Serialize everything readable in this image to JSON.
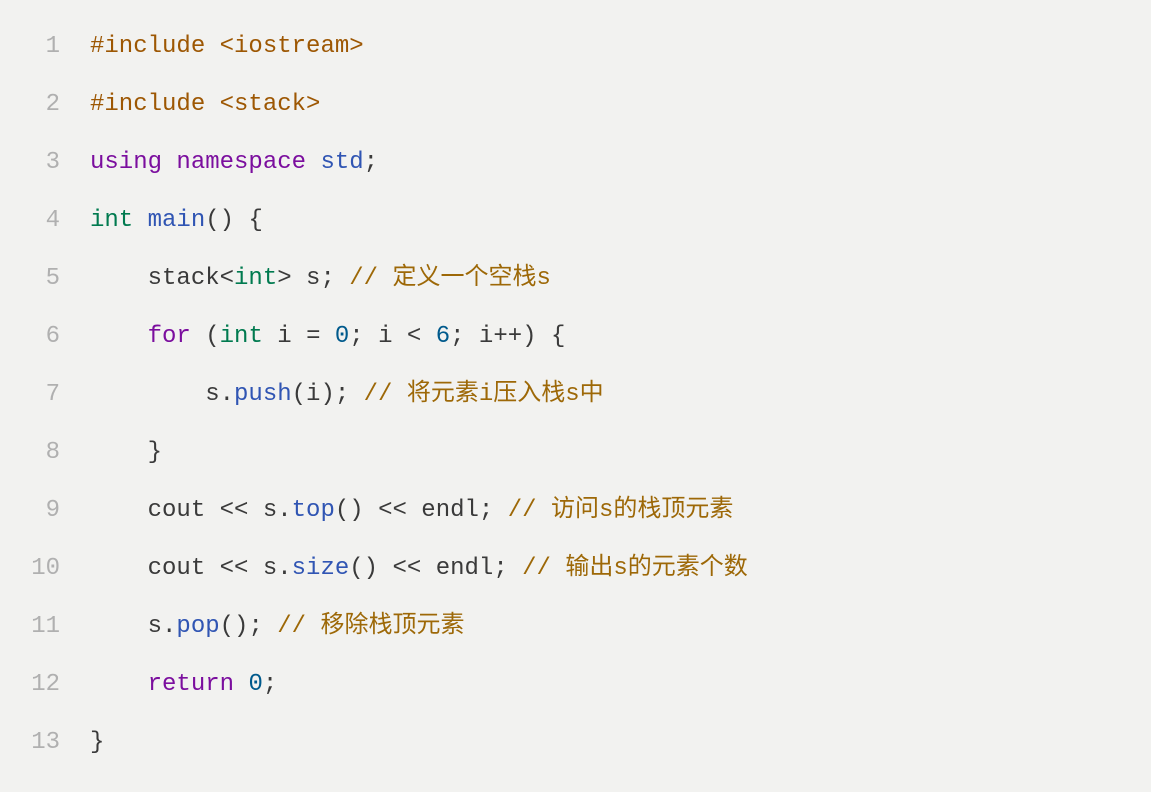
{
  "code": {
    "lines": [
      {
        "num": "1",
        "indent": "",
        "tokens": [
          {
            "cls": "tok-preproc",
            "text": "#include <iostream>"
          }
        ]
      },
      {
        "num": "2",
        "indent": "",
        "tokens": [
          {
            "cls": "tok-preproc",
            "text": "#include <stack>"
          }
        ]
      },
      {
        "num": "3",
        "indent": "",
        "tokens": [
          {
            "cls": "tok-keyword",
            "text": "using"
          },
          {
            "cls": "tok-plain",
            "text": " "
          },
          {
            "cls": "tok-keyword",
            "text": "namespace"
          },
          {
            "cls": "tok-plain",
            "text": " "
          },
          {
            "cls": "tok-func",
            "text": "std"
          },
          {
            "cls": "tok-punct",
            "text": ";"
          }
        ]
      },
      {
        "num": "4",
        "indent": "",
        "tokens": [
          {
            "cls": "tok-type",
            "text": "int"
          },
          {
            "cls": "tok-plain",
            "text": " "
          },
          {
            "cls": "tok-func",
            "text": "main"
          },
          {
            "cls": "tok-punct",
            "text": "() {"
          }
        ]
      },
      {
        "num": "5",
        "indent": "    ",
        "tokens": [
          {
            "cls": "tok-ident",
            "text": "stack"
          },
          {
            "cls": "tok-punct",
            "text": "<"
          },
          {
            "cls": "tok-type",
            "text": "int"
          },
          {
            "cls": "tok-punct",
            "text": "> s; "
          },
          {
            "cls": "tok-comment",
            "text": "// 定义一个空栈s"
          }
        ]
      },
      {
        "num": "6",
        "indent": "    ",
        "tokens": [
          {
            "cls": "tok-keyword",
            "text": "for"
          },
          {
            "cls": "tok-punct",
            "text": " ("
          },
          {
            "cls": "tok-type",
            "text": "int"
          },
          {
            "cls": "tok-plain",
            "text": " i "
          },
          {
            "cls": "tok-op",
            "text": "="
          },
          {
            "cls": "tok-plain",
            "text": " "
          },
          {
            "cls": "tok-number",
            "text": "0"
          },
          {
            "cls": "tok-punct",
            "text": "; i "
          },
          {
            "cls": "tok-op",
            "text": "<"
          },
          {
            "cls": "tok-plain",
            "text": " "
          },
          {
            "cls": "tok-number",
            "text": "6"
          },
          {
            "cls": "tok-punct",
            "text": "; i"
          },
          {
            "cls": "tok-op",
            "text": "++"
          },
          {
            "cls": "tok-punct",
            "text": ") {"
          }
        ]
      },
      {
        "num": "7",
        "indent": "        ",
        "tokens": [
          {
            "cls": "tok-ident",
            "text": "s"
          },
          {
            "cls": "tok-punct",
            "text": "."
          },
          {
            "cls": "tok-func",
            "text": "push"
          },
          {
            "cls": "tok-punct",
            "text": "(i); "
          },
          {
            "cls": "tok-comment",
            "text": "// 将元素i压入栈s中"
          }
        ]
      },
      {
        "num": "8",
        "indent": "    ",
        "tokens": [
          {
            "cls": "tok-punct",
            "text": "}"
          }
        ]
      },
      {
        "num": "9",
        "indent": "    ",
        "tokens": [
          {
            "cls": "tok-ident",
            "text": "cout "
          },
          {
            "cls": "tok-op",
            "text": "<<"
          },
          {
            "cls": "tok-ident",
            "text": " s"
          },
          {
            "cls": "tok-punct",
            "text": "."
          },
          {
            "cls": "tok-func",
            "text": "top"
          },
          {
            "cls": "tok-punct",
            "text": "() "
          },
          {
            "cls": "tok-op",
            "text": "<<"
          },
          {
            "cls": "tok-ident",
            "text": " endl"
          },
          {
            "cls": "tok-punct",
            "text": "; "
          },
          {
            "cls": "tok-comment",
            "text": "// 访问s的栈顶元素"
          }
        ]
      },
      {
        "num": "10",
        "indent": "    ",
        "tokens": [
          {
            "cls": "tok-ident",
            "text": "cout "
          },
          {
            "cls": "tok-op",
            "text": "<<"
          },
          {
            "cls": "tok-ident",
            "text": " s"
          },
          {
            "cls": "tok-punct",
            "text": "."
          },
          {
            "cls": "tok-func",
            "text": "size"
          },
          {
            "cls": "tok-punct",
            "text": "() "
          },
          {
            "cls": "tok-op",
            "text": "<<"
          },
          {
            "cls": "tok-ident",
            "text": " endl"
          },
          {
            "cls": "tok-punct",
            "text": "; "
          },
          {
            "cls": "tok-comment",
            "text": "// 输出s的元素个数"
          }
        ]
      },
      {
        "num": "11",
        "indent": "    ",
        "tokens": [
          {
            "cls": "tok-ident",
            "text": "s"
          },
          {
            "cls": "tok-punct",
            "text": "."
          },
          {
            "cls": "tok-func",
            "text": "pop"
          },
          {
            "cls": "tok-punct",
            "text": "(); "
          },
          {
            "cls": "tok-comment",
            "text": "// 移除栈顶元素"
          }
        ]
      },
      {
        "num": "12",
        "indent": "    ",
        "tokens": [
          {
            "cls": "tok-keyword",
            "text": "return"
          },
          {
            "cls": "tok-plain",
            "text": " "
          },
          {
            "cls": "tok-number",
            "text": "0"
          },
          {
            "cls": "tok-punct",
            "text": ";"
          }
        ]
      },
      {
        "num": "13",
        "indent": "",
        "tokens": [
          {
            "cls": "tok-punct",
            "text": "}"
          }
        ]
      }
    ]
  }
}
